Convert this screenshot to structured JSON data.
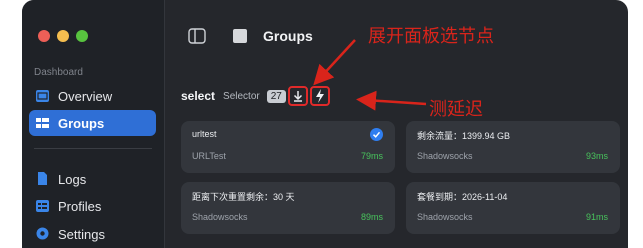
{
  "sidebar": {
    "section_label": "Dashboard",
    "items": [
      {
        "label": "Overview",
        "icon": "overview-icon",
        "active": false
      },
      {
        "label": "Groups",
        "icon": "groups-icon",
        "active": true
      },
      {
        "label": "Logs",
        "icon": "logs-icon",
        "active": false
      },
      {
        "label": "Profiles",
        "icon": "profiles-icon",
        "active": false
      },
      {
        "label": "Settings",
        "icon": "settings-icon",
        "active": false
      }
    ]
  },
  "header": {
    "title": "Groups"
  },
  "group": {
    "name": "select",
    "type_label": "Selector",
    "count": "27"
  },
  "cards": [
    {
      "name": "urltest",
      "type": "URLTest",
      "delay": "79ms",
      "selected": true
    },
    {
      "name": "剩余流量：1399.94 GB",
      "type": "Shadowsocks",
      "delay": "93ms",
      "selected": false
    },
    {
      "name": "距离下次重置剩余：30 天",
      "type": "Shadowsocks",
      "delay": "89ms",
      "selected": false
    },
    {
      "name": "套餐到期：2026-11-04",
      "type": "Shadowsocks",
      "delay": "91ms",
      "selected": false
    }
  ],
  "annotations": {
    "expand_label": "展开面板选节点",
    "test_latency_label": "测延迟",
    "color": "#d9241b"
  },
  "colors": {
    "accent": "#2f6fd6",
    "delay_good": "#48c35c",
    "sidebar_bg": "#1f2227",
    "main_bg": "#25272c"
  }
}
